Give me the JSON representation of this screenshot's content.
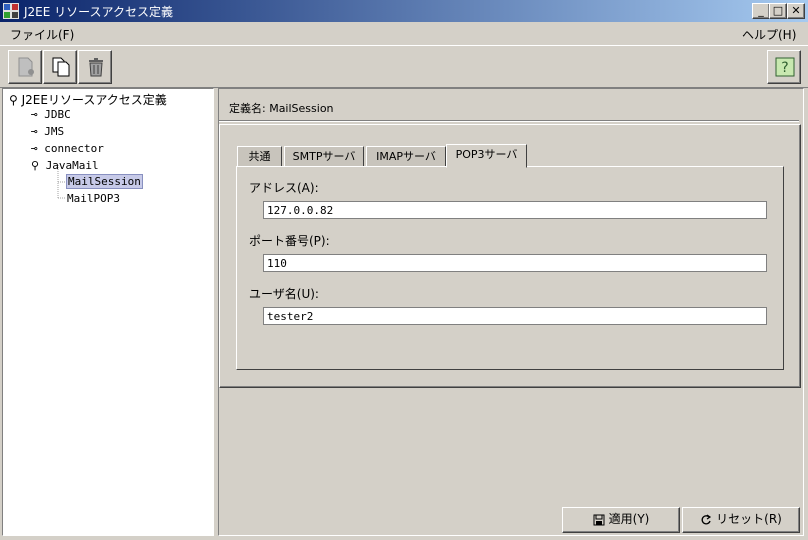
{
  "window": {
    "title": "J2EE リソースアクセス定義"
  },
  "menu": {
    "file": "ファイル(F)",
    "help": "ヘルプ(H)"
  },
  "toolbar": {
    "buttons": [
      "new-icon",
      "copy-icon",
      "trash-icon",
      "help-icon"
    ]
  },
  "tree": {
    "root": "J2EEリソースアクセス定義",
    "nodes": [
      "JDBC",
      "JMS",
      "connector",
      "JavaMail"
    ],
    "children": [
      "MailSession",
      "MailPOP3"
    ],
    "selected": "MailSession"
  },
  "detail": {
    "definition_label": "定義名: MailSession",
    "tabs": [
      "共通",
      "SMTPサーバ",
      "IMAPサーバ",
      "POP3サーバ"
    ],
    "active_tab": "POP3サーバ",
    "fields": [
      {
        "label": "アドレス(A):",
        "value": "127.0.0.82"
      },
      {
        "label": "ポート番号(P):",
        "value": "110"
      },
      {
        "label": "ユーザ名(U):",
        "value": "tester2"
      }
    ]
  },
  "buttons": {
    "apply": "適用(Y)",
    "reset": "リセット(R)"
  }
}
